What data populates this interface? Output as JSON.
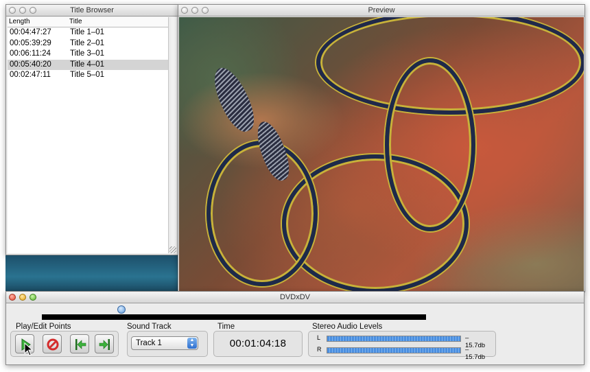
{
  "title_browser": {
    "title": "Title Browser",
    "col_length": "Length",
    "col_title": "Title",
    "rows": [
      {
        "length": "00:04:47:27",
        "title": "Title 1–01"
      },
      {
        "length": "00:05:39:29",
        "title": "Title 2–01"
      },
      {
        "length": "00:06:11:24",
        "title": "Title 3–01"
      },
      {
        "length": "00:05:40:20",
        "title": "Title 4–01",
        "selected": true
      },
      {
        "length": "00:02:47:11",
        "title": "Title 5–01"
      }
    ]
  },
  "preview": {
    "title": "Preview"
  },
  "main": {
    "title": "DVDxDV",
    "scrubber_position": 0.2,
    "play_edit": {
      "label": "Play/Edit Points",
      "buttons": [
        "play-icon",
        "stop-icon",
        "set-in-point-icon",
        "set-out-point-icon"
      ]
    },
    "sound_track": {
      "label": "Sound Track",
      "selected": "Track 1"
    },
    "time": {
      "label": "Time",
      "value": "00:01:04:18"
    },
    "audio_levels": {
      "label": "Stereo Audio Levels",
      "left_label": "L",
      "left_db": "–15.7db",
      "left_level": 1.0,
      "right_label": "R",
      "right_db": "–15.7db",
      "right_level": 1.0
    }
  },
  "colors": {
    "accent_blue": "#5a97d8",
    "button_green": "#3cb23c",
    "stop_red": "#d42c2c"
  }
}
